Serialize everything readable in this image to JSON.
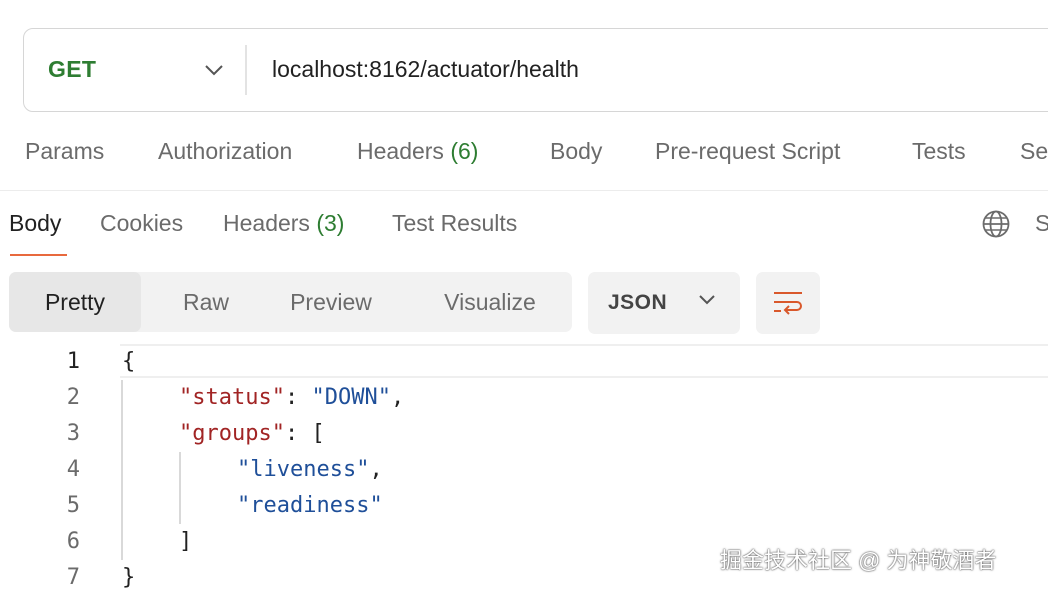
{
  "request": {
    "method": "GET",
    "url": "localhost:8162/actuator/health"
  },
  "request_tabs": [
    {
      "label": "Params",
      "count": ""
    },
    {
      "label": "Authorization",
      "count": ""
    },
    {
      "label": "Headers",
      "count": "(6)"
    },
    {
      "label": "Body",
      "count": ""
    },
    {
      "label": "Pre-request Script",
      "count": ""
    },
    {
      "label": "Tests",
      "count": ""
    },
    {
      "label": "Se",
      "count": ""
    }
  ],
  "response_tabs": [
    {
      "label": "Body",
      "count": "",
      "active": true
    },
    {
      "label": "Cookies",
      "count": ""
    },
    {
      "label": "Headers",
      "count": "(3)"
    },
    {
      "label": "Test Results",
      "count": ""
    }
  ],
  "response_right": {
    "icon": "globe-icon",
    "truncated_label": "S"
  },
  "view_modes": [
    "Pretty",
    "Raw",
    "Preview",
    "Visualize"
  ],
  "active_view_mode": "Pretty",
  "format_select": {
    "value": "JSON"
  },
  "wrap_button": {
    "icon": "wrap-lines-icon"
  },
  "code": {
    "line_numbers": [
      "1",
      "2",
      "3",
      "4",
      "5",
      "6",
      "7"
    ],
    "lines": {
      "l1": "{",
      "l2_key": "\"status\"",
      "l2_sep": ": ",
      "l2_val": "\"DOWN\"",
      "l2_end": ",",
      "l3_key": "\"groups\"",
      "l3_sep": ": [",
      "l4_val": "\"liveness\"",
      "l4_end": ",",
      "l5_val": "\"readiness\"",
      "l6": "]",
      "l7": "}"
    }
  },
  "watermark": "掘金技术社区 @ 为神敬酒者",
  "colors": {
    "method_get": "#2e7d32",
    "accent": "#e8693d",
    "json_key": "#a12424",
    "json_string": "#1f4f99"
  }
}
